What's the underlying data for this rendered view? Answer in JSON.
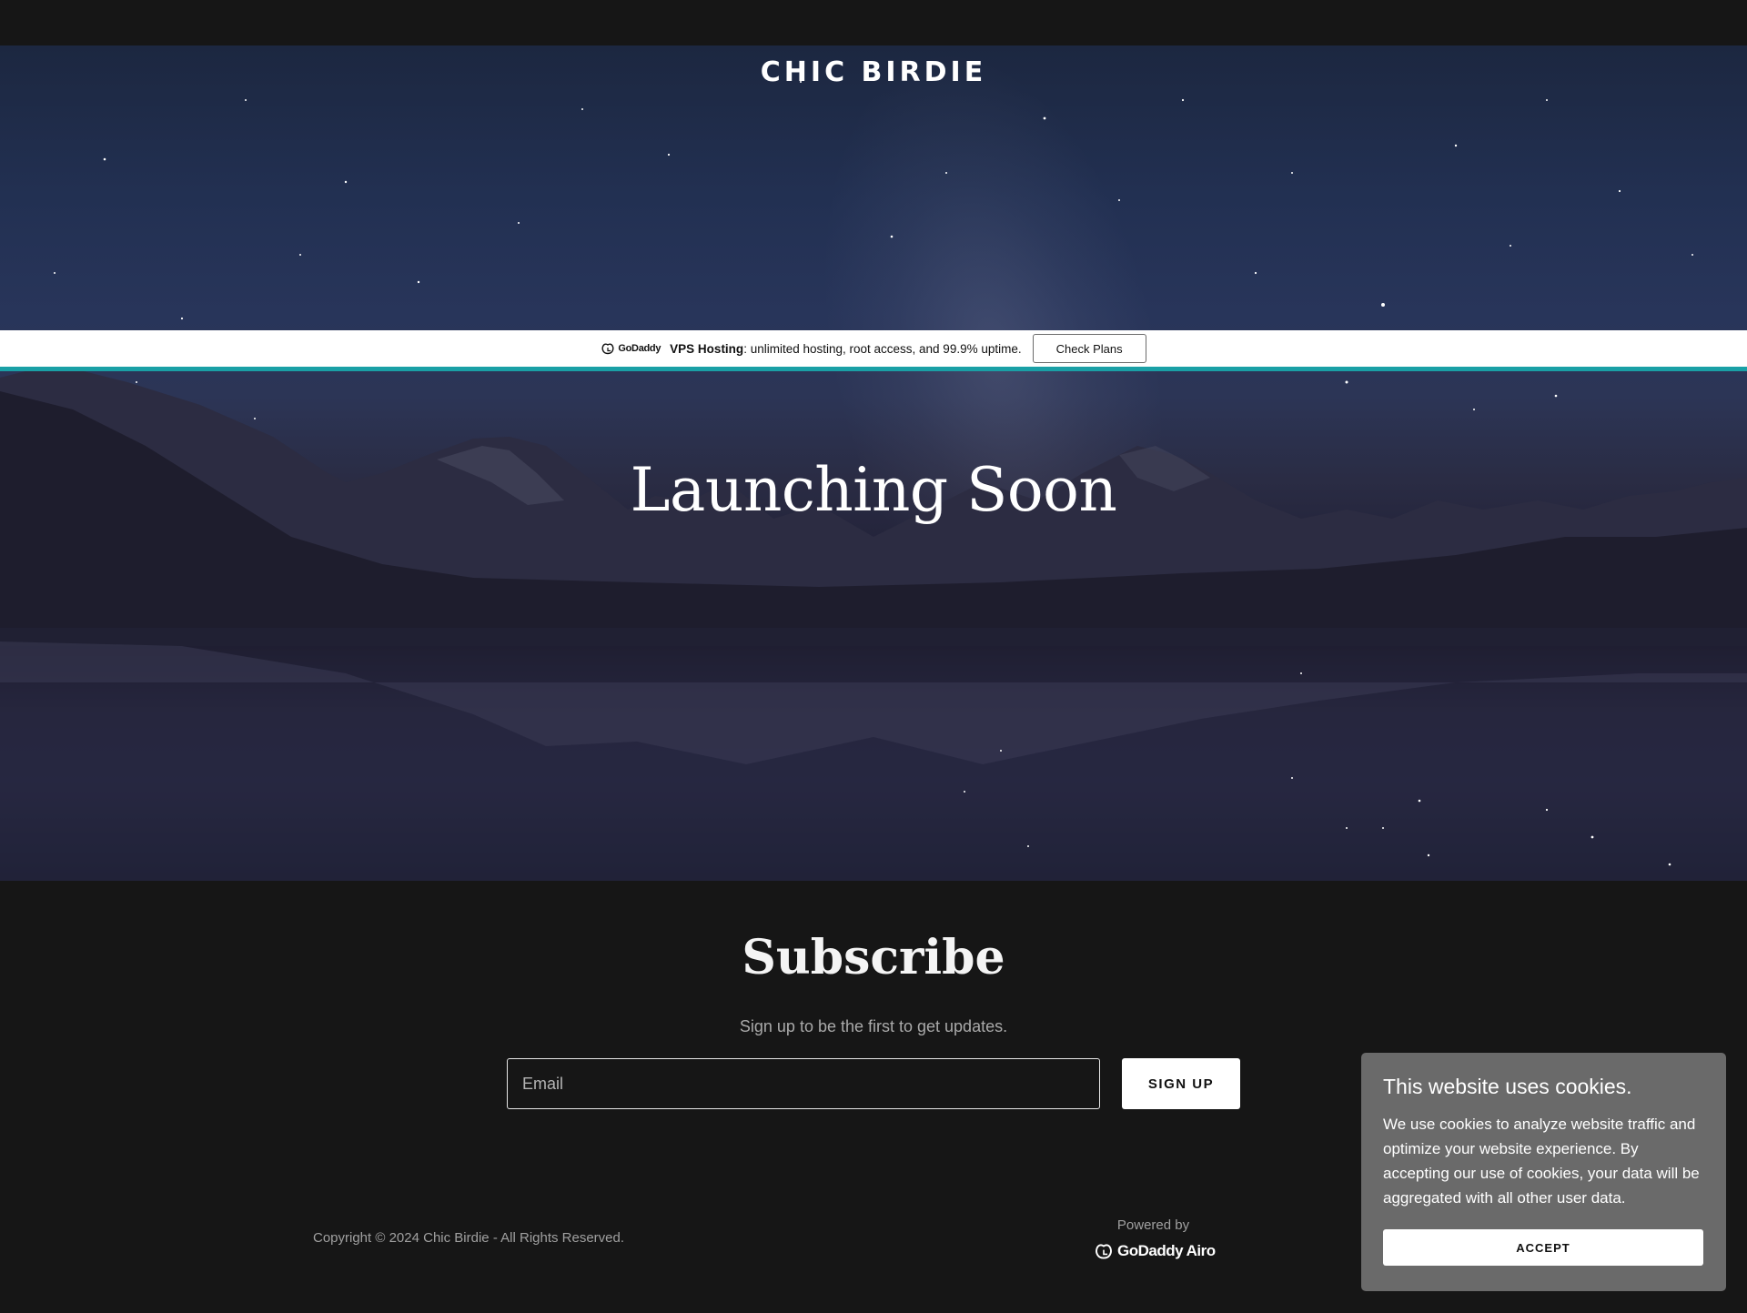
{
  "header": {
    "site_title": "CHIC BIRDIE"
  },
  "ad_banner": {
    "logo_text": "GoDaddy",
    "product": "VPS Hosting",
    "description": ": unlimited hosting, root access, and 99.9% uptime.",
    "button_label": "Check Plans",
    "accent_color": "#1aa0a6"
  },
  "hero": {
    "heading": "Launching Soon"
  },
  "subscribe": {
    "title": "Subscribe",
    "subtitle": "Sign up to be the first to get updates.",
    "email_placeholder": "Email",
    "button_label": "SIGN UP"
  },
  "footer": {
    "copyright": "Copyright © 2024 Chic Birdie - All Rights Reserved.",
    "powered_by": "Powered by",
    "brand": "GoDaddy Airo"
  },
  "cookie_banner": {
    "title": "This website uses cookies.",
    "text": "We use cookies to analyze website traffic and optimize your website experience. By accepting our use of cookies, your data will be aggregated with all other user data.",
    "button_label": "ACCEPT"
  },
  "icons": [
    "godaddy-logo-icon",
    "godaddy-airo-logo-icon"
  ]
}
